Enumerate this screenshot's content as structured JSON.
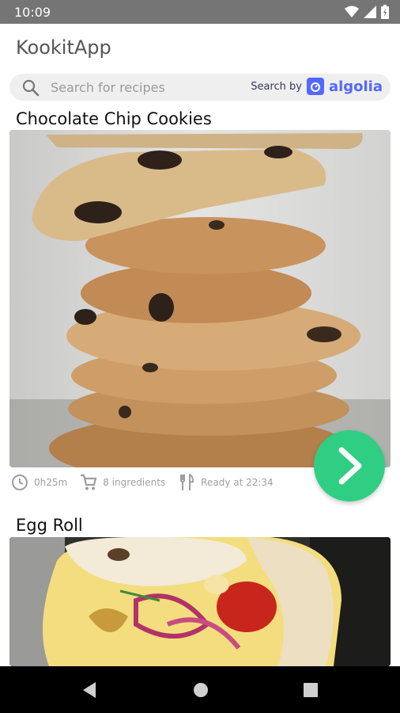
{
  "status_bar": {
    "time": "10:09"
  },
  "app": {
    "title": "KookitApp"
  },
  "search": {
    "placeholder": "Search for recipes",
    "search_by_label": "Search by",
    "brand": "algolia",
    "brand_color": "#5468ff"
  },
  "recipes": [
    {
      "title": "Chocolate Chip Cookies",
      "duration": "0h25m",
      "ingredients": "8 ingredients",
      "ready_at": "Ready at 22:34"
    },
    {
      "title": "Egg Roll"
    }
  ],
  "accent_color": "#2fce83",
  "icons": [
    "wifi-icon",
    "signal-icon",
    "battery-icon",
    "search-icon",
    "clock-icon",
    "cart-icon",
    "fork-knife-icon",
    "chevron-right-icon",
    "back-icon",
    "home-icon",
    "recents-icon"
  ]
}
